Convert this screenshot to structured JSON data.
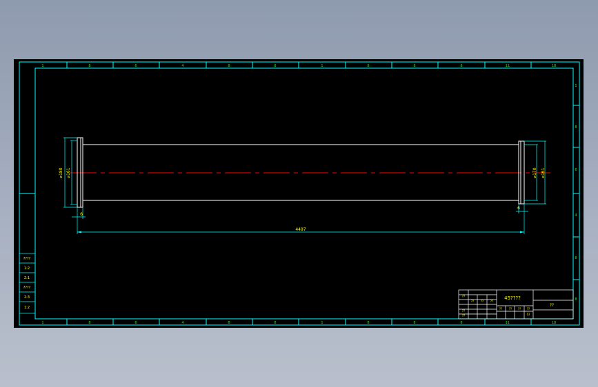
{
  "drawing": {
    "zone_numbers_top": [
      "1",
      "8",
      "6",
      "4",
      "8",
      "8",
      "1",
      "8",
      "8",
      "8",
      "11",
      "18"
    ],
    "zone_numbers_bottom": [
      "1",
      "8",
      "6",
      "4",
      "8",
      "8",
      "1",
      "8",
      "8",
      "8",
      "11",
      "18"
    ],
    "dimensions": {
      "left_outer_dia": "⌀180",
      "left_inner_dia": "⌀161",
      "right_outer_dia": "⌀170",
      "right_inner_dia": "⌀161",
      "left_flange_width": "6",
      "right_flange_width": "6",
      "overall_length": "4497"
    },
    "left_table_rows": [
      "????",
      "1:2",
      "2:1",
      "????",
      "2:3",
      "1:2"
    ],
    "title_block": {
      "material": "45????",
      "sheet": "??",
      "small_cells": [
        "??",
        "??",
        "??",
        "??",
        "??",
        "??",
        "??",
        "??",
        "??",
        "??",
        "12",
        "??",
        "??",
        "??",
        "??",
        "??",
        "??",
        "??"
      ]
    },
    "colors": {
      "background": "#000000",
      "frame": "#00ffff",
      "part": "#ffffff",
      "centerline": "#ff0000",
      "zone_text": "#00ff00",
      "dim_text": "#ffff00"
    }
  }
}
